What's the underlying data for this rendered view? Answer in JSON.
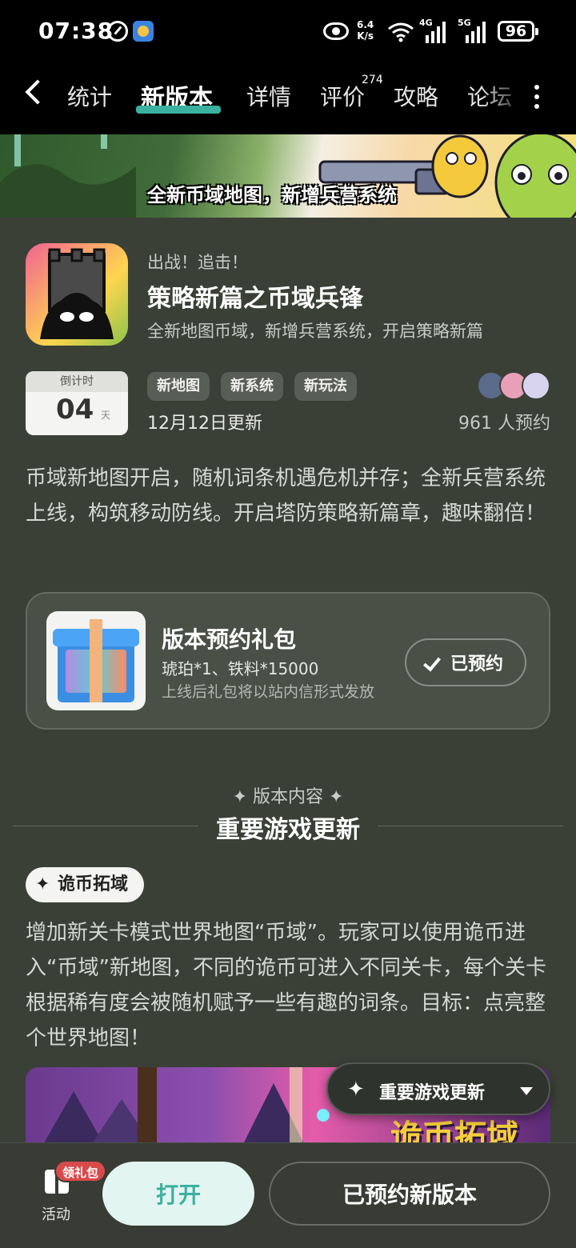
{
  "status_bar": {
    "time": "07:38",
    "net_speed_value": "6.4",
    "net_speed_unit": "K/s",
    "signal_1": "4G",
    "signal_2": "5G",
    "battery": "96"
  },
  "tabs": [
    {
      "label": "统计",
      "active": false
    },
    {
      "label": "新版本",
      "active": true
    },
    {
      "label": "详情",
      "active": false
    },
    {
      "label": "评价",
      "active": false,
      "badge": "274"
    },
    {
      "label": "攻略",
      "active": false
    },
    {
      "label": "论坛",
      "active": false
    }
  ],
  "banner": {
    "text": "全新币域地图，新增兵营系统"
  },
  "header": {
    "eyebrow": "出战！追击！",
    "title": "策略新篇之币域兵锋",
    "subtitle": "全新地图币域，新增兵营系统，开启策略新篇"
  },
  "countdown": {
    "label": "倒计时",
    "value": "04",
    "unit": "天"
  },
  "tags": [
    "新地图",
    "新系统",
    "新玩法"
  ],
  "update_date": "12月12日更新",
  "reservations": "961 人预约",
  "description": "币域新地图开启，随机词条机遇危机并存；全新兵营系统上线，构筑移动防线。开启塔防策略新篇章，趣味翻倍！",
  "gift": {
    "title": "版本预约礼包",
    "items": "琥珀*1、铁料*15000",
    "note": "上线后礼包将以站内信形式发放",
    "button": "已预约"
  },
  "section": {
    "label": "✦ 版本内容 ✦",
    "title": "重要游戏更新"
  },
  "feature": {
    "chip": "诡币拓域",
    "text": "增加新关卡模式世界地图“币域”。玩家可以使用诡币进入“币域”新地图，不同的诡币可进入不同关卡，每个关卡根据稀有度会被随机赋予一些有趣的词条。目标：点亮整个世界地图！",
    "image_title": "诡币拓域"
  },
  "floating_nav": {
    "label": "重要游戏更新"
  },
  "bottom_bar": {
    "activity_badge": "领礼包",
    "activity_label": "活动",
    "open_button": "打开",
    "reserved_version_button": "已预约新版本"
  },
  "colors": {
    "background": "#3a4036",
    "accent": "#3bb1a0",
    "badge": "#d94a4a"
  }
}
